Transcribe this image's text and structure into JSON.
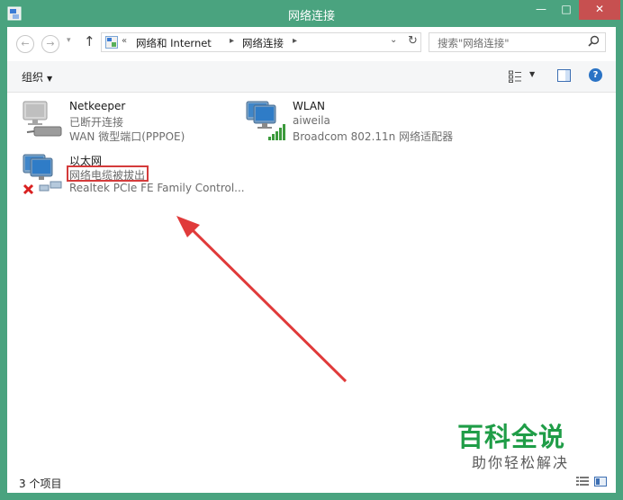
{
  "window": {
    "title": "网络连接"
  },
  "titlebar": {
    "minimize": "—",
    "maximize": "□",
    "close": "✕"
  },
  "address": {
    "breadcrumb": [
      "«",
      "网络和 Internet",
      "网络连接"
    ],
    "search_placeholder": "搜索\"网络连接\""
  },
  "toolbar": {
    "organize": "组织"
  },
  "connections": [
    {
      "name": "Netkeeper",
      "status": "已断开连接",
      "device": "WAN 微型端口(PPPOE)",
      "icon": "disconnected-network-icon"
    },
    {
      "name": "WLAN",
      "status": "aiweila",
      "device": "Broadcom 802.11n 网络适配器",
      "icon": "wireless-network-icon"
    },
    {
      "name": "以太网",
      "status": "网络电缆被拔出",
      "device": "Realtek PCIe FE Family Control...",
      "icon": "ethernet-unplugged-icon"
    }
  ],
  "status": {
    "count": "3 个项目"
  },
  "watermark": {
    "title": "百科全说",
    "subtitle": "助你轻松解决"
  },
  "colors": {
    "titlebar": "#4aa37f",
    "close": "#c75050",
    "annotation": "#d43b3b",
    "watermark": "#1f9d47"
  }
}
